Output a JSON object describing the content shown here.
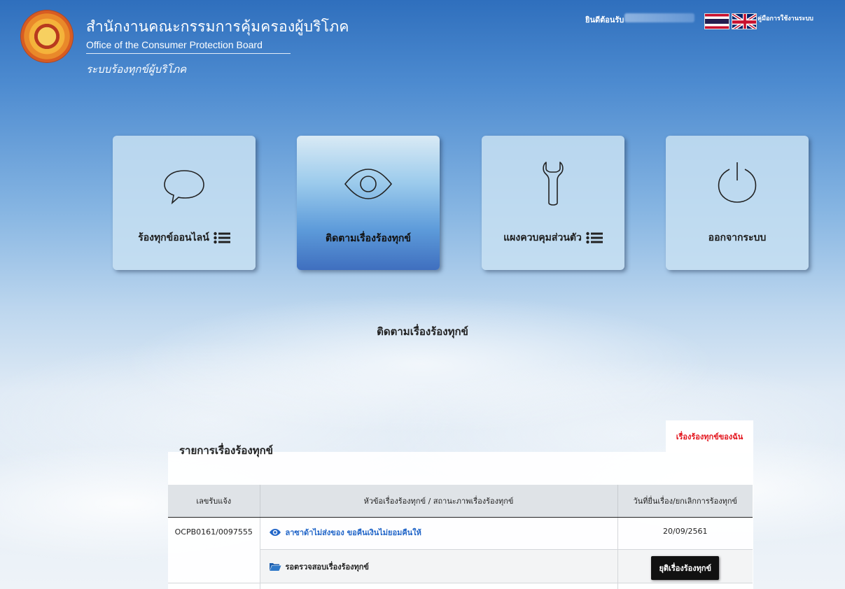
{
  "header": {
    "org_thai": "สำนักงานคณะกรรมการคุ้มครองผู้บริโภค",
    "org_english": "Office of the Consumer Protection Board",
    "system_name": "ระบบร้องทุกข์ผู้บริโภค",
    "welcome_label": "ยินดีต้อนรับ",
    "manual_link": "คู่มือการใช้งานระบบ"
  },
  "menu": {
    "tiles": [
      {
        "label": "ร้องทุกข์ออนไลน์",
        "icon": "speech-bubble-icon",
        "active": false
      },
      {
        "label": "ติดตามเรื่องร้องทุกข์",
        "icon": "eye-icon",
        "active": true
      },
      {
        "label": "แผงควบคุมส่วนตัว",
        "icon": "wrench-icon",
        "active": false
      },
      {
        "label": "ออกจากระบบ",
        "icon": "power-icon",
        "active": false
      }
    ]
  },
  "section_title": "ติดตามเรื่องร้องทุกข์",
  "complaints": {
    "title": "รายการเรื่องร้องทุกข์",
    "my_tab": "เรื่องร้องทุกข์ของฉัน",
    "columns": [
      "เลขรับแจ้ง",
      "หัวข้อเรื่องร้องทุกข์ / สถานะภาพเรื่องร้องทุกข์",
      "วันที่ยื่นเรื่อง/ยกเลิกการร้องทุกข์"
    ],
    "rows": [
      {
        "id": "OCPB0161/0097555",
        "subject": "ลาซาด้าไม่ส่งของ ขอคืนเงินไม่ยอมคืนให้",
        "date": "20/09/2561",
        "status": "รอตรวจสอบเรื่องร้องทุกข์",
        "action": "ยุติเรื่องร้องทุกข์"
      }
    ]
  },
  "colors": {
    "active_tile": "#3f6fbf",
    "link": "#2266c8",
    "my_tab_text": "#e3141c"
  }
}
